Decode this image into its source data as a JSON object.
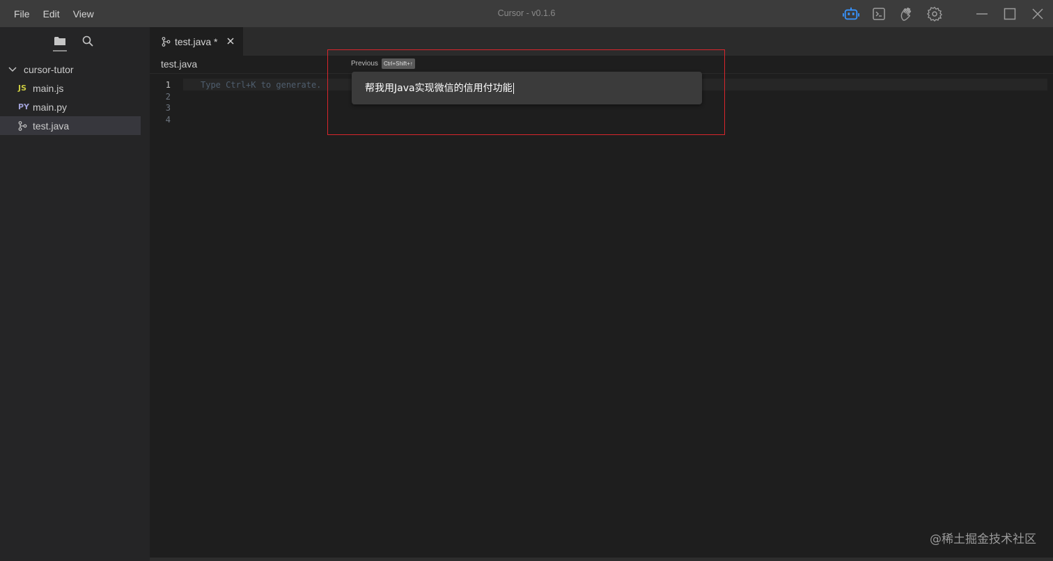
{
  "menu": {
    "file": "File",
    "edit": "Edit",
    "view": "View"
  },
  "app_title": "Cursor - v0.1.6",
  "title_icons": [
    "robot-icon",
    "terminal-icon",
    "hand-wave-icon",
    "gear-icon"
  ],
  "window_controls": [
    "minimize-icon",
    "maximize-icon",
    "close-icon"
  ],
  "sidebar": {
    "tabs": [
      "folder-icon",
      "search-icon"
    ],
    "folder": "cursor-tutor",
    "files": [
      {
        "icon": "JS",
        "name": "main.js",
        "selected": false
      },
      {
        "icon": "PY",
        "name": "main.py",
        "selected": false
      },
      {
        "icon": "branch-icon",
        "name": "test.java",
        "selected": true
      }
    ]
  },
  "editor": {
    "tab": {
      "label": "test.java *"
    },
    "breadcrumb": "test.java",
    "line_numbers": [
      "1",
      "2",
      "3",
      "4"
    ],
    "placeholder_hint": "Type Ctrl+K to generate."
  },
  "prompt": {
    "previous_label": "Previous",
    "shortcut": "Ctrl+Shift+↑",
    "value": "帮我用Java实现微信的信用付功能"
  },
  "colors": {
    "accent_icon": "#3794ff",
    "highlight_border": "#d9262c"
  },
  "watermark": "@稀土掘金技术社区"
}
